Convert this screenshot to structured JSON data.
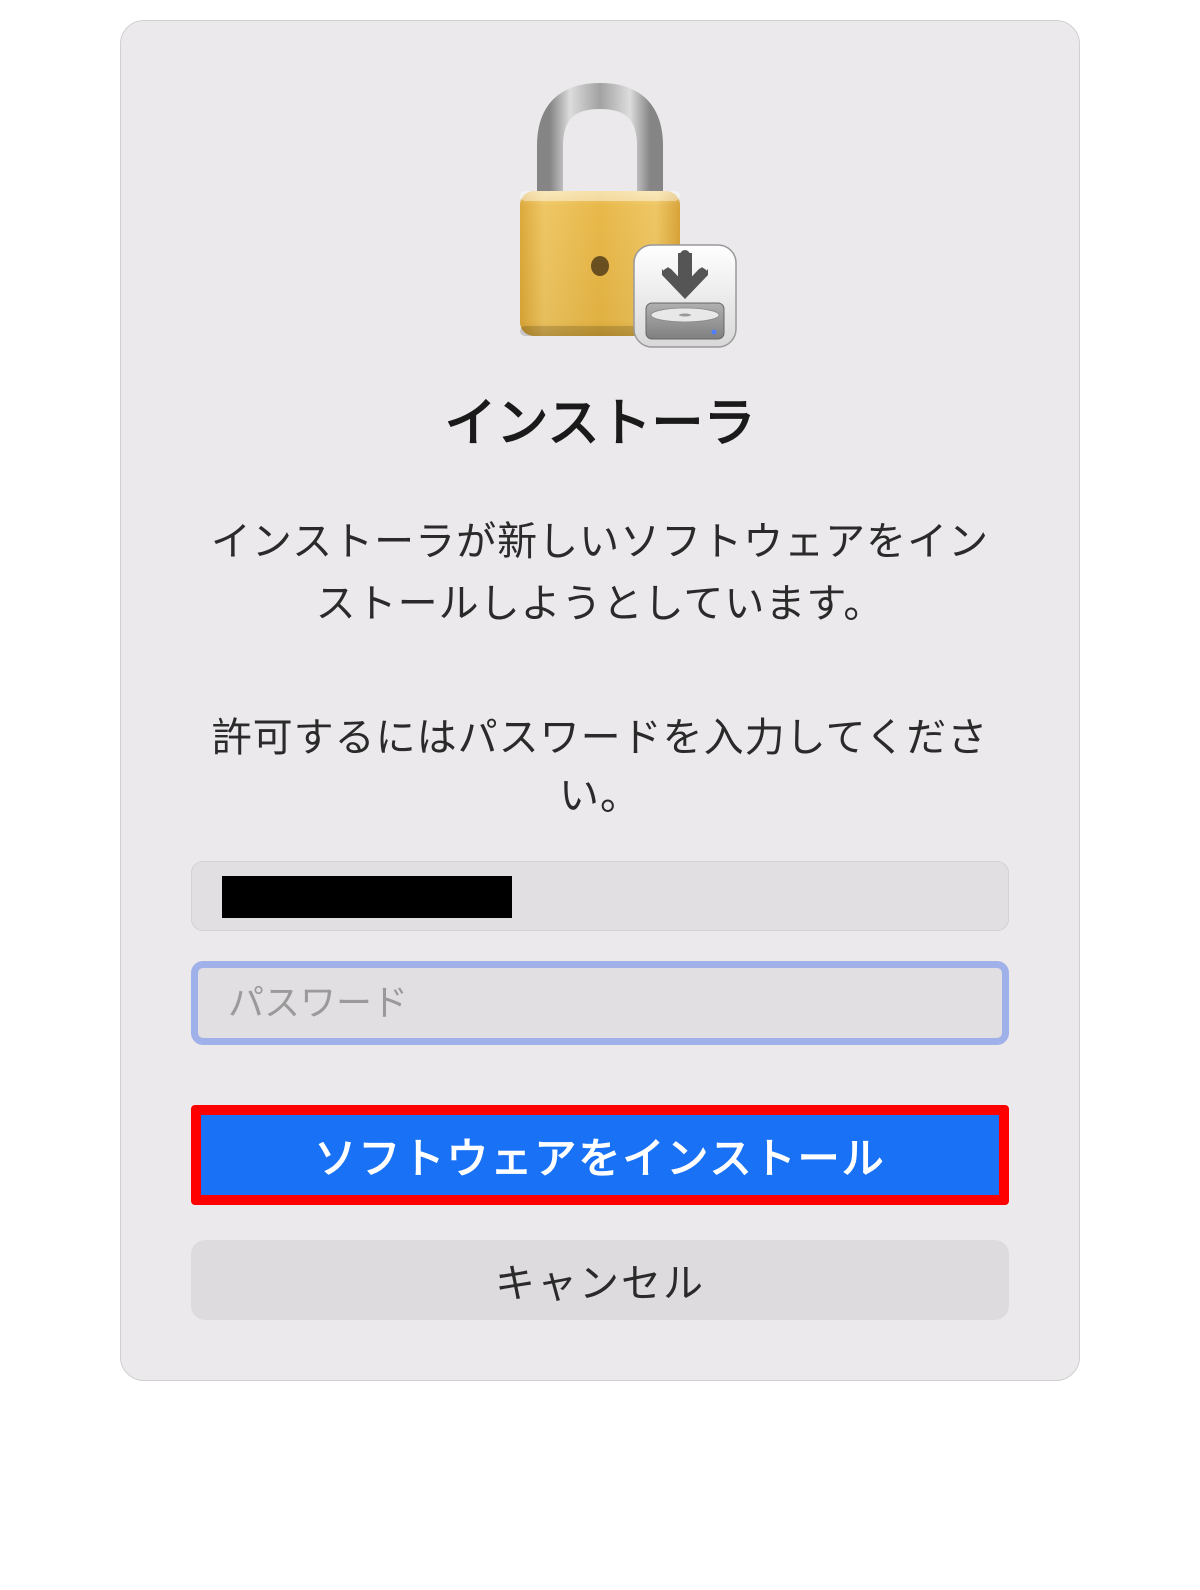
{
  "dialog": {
    "title": "インストーラ",
    "message": "インストーラが新しいソフトウェアをインストールしようとしています。",
    "prompt": "許可するにはパスワードを入力してください。",
    "username_value": "",
    "password_placeholder": "パスワード",
    "install_button_label": "ソフトウェアをインストール",
    "cancel_button_label": "キャンセル",
    "icons": {
      "lock": "lock-icon",
      "install_badge": "download-arrow-icon"
    }
  }
}
